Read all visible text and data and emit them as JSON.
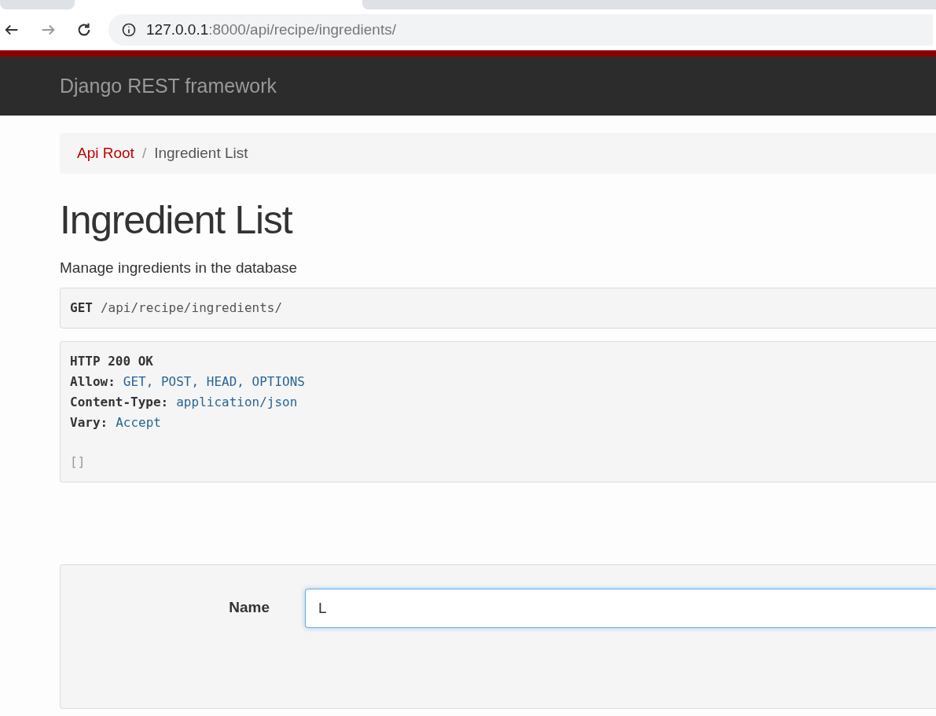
{
  "browser": {
    "address_host": "127.0.0.1",
    "address_path": ":8000/api/recipe/ingredients/"
  },
  "navbar": {
    "brand": "Django REST framework"
  },
  "breadcrumbs": [
    {
      "label": "Api Root",
      "link": true
    },
    {
      "label": "Ingredient List",
      "link": false
    }
  ],
  "breadcrumb_separator": "/",
  "page": {
    "title": "Ingredient List",
    "description": "Manage ingredients in the database"
  },
  "request": {
    "method": "GET",
    "path": "/api/recipe/ingredients/"
  },
  "response": {
    "status": "HTTP 200 OK",
    "headers": [
      {
        "name": "Allow:",
        "value": "GET, POST, HEAD, OPTIONS"
      },
      {
        "name": "Content-Type:",
        "value": "application/json"
      },
      {
        "name": "Vary:",
        "value": "Accept"
      }
    ],
    "body": "[]"
  },
  "form": {
    "fields": [
      {
        "label": "Name",
        "value": "L"
      }
    ]
  }
}
